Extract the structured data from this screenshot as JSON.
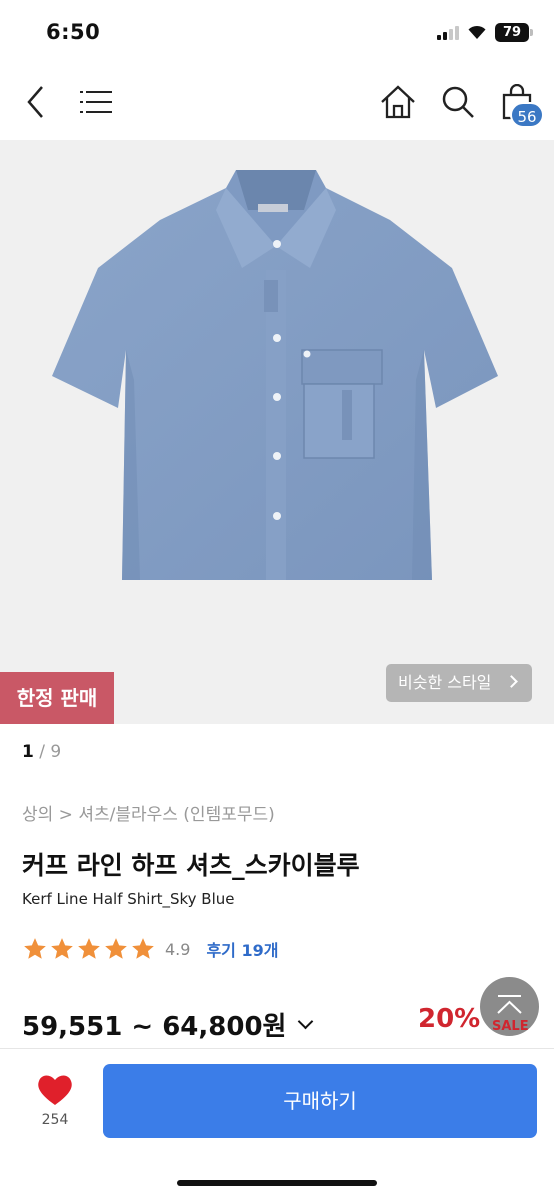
{
  "status_bar": {
    "time": "6:50",
    "battery": "79"
  },
  "nav": {
    "icons": [
      "back-icon",
      "menu-icon",
      "home-icon",
      "search-icon",
      "shopping-bag-icon"
    ],
    "cart_count": "56"
  },
  "product_image": {
    "limited_badge": "한정 판매",
    "similar_style": "비슷한 스타일",
    "page_current": "1",
    "page_total": "9"
  },
  "product": {
    "breadcrumb": "상의 > 셔츠/블라우스 (인템포무드)",
    "title_kr": "커프 라인 하프 셔츠_스카이블루",
    "title_en": "Kerf Line Half Shirt_Sky Blue",
    "rating": "4.9",
    "star_count": 5,
    "reviews": "후기 19개",
    "price": "59,551 ~ 64,800원",
    "discount": "20%",
    "sale_label": "SALE"
  },
  "bottom_bar": {
    "likes": "254",
    "buy_label": "구매하기"
  },
  "colors": {
    "accent_blue": "#3b7de8",
    "badge_red": "#c95866",
    "discount_red": "#d0262f",
    "star_orange": "#f0903a",
    "heart_red": "#e0202b"
  }
}
